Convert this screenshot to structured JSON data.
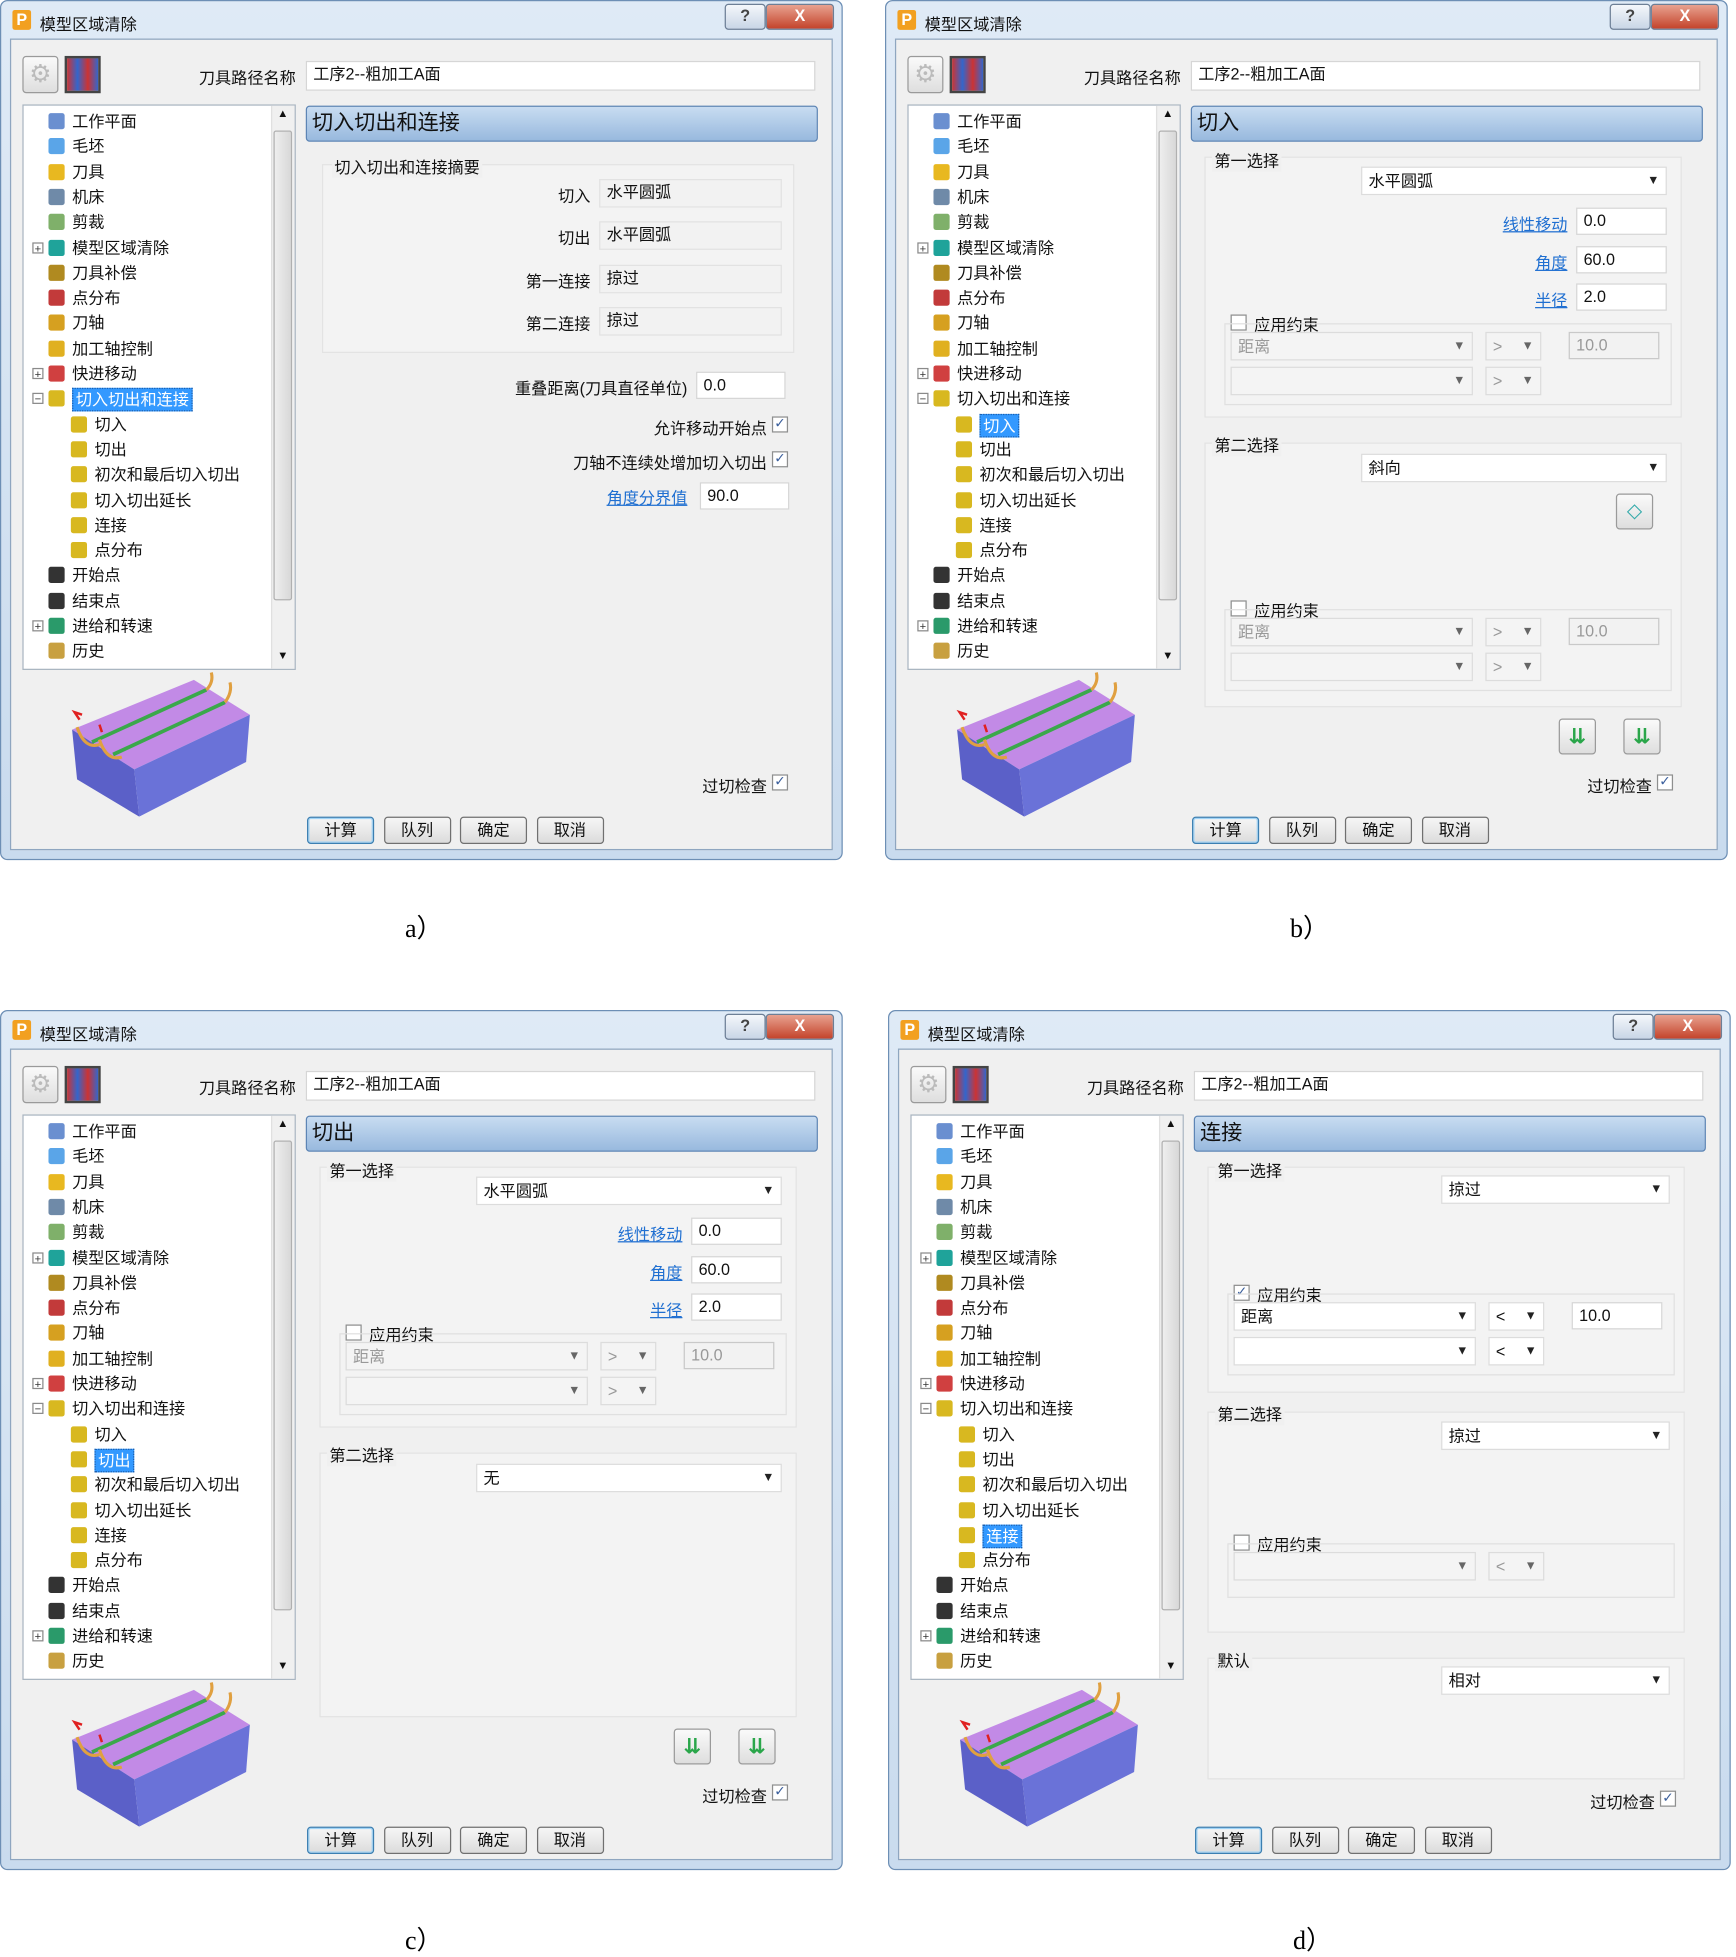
{
  "tree_items": [
    {
      "label": "工作平面",
      "level": 0,
      "icon": "workplane-icon",
      "color": "#6a8fd0"
    },
    {
      "label": "毛坯",
      "level": 0,
      "icon": "block-icon",
      "color": "#5aa5e8"
    },
    {
      "label": "刀具",
      "level": 0,
      "icon": "tool-icon",
      "color": "#e8b820"
    },
    {
      "label": "机床",
      "level": 0,
      "icon": "machine-tool-icon",
      "color": "#6f8aa8"
    },
    {
      "label": "剪裁",
      "level": 0,
      "icon": "limit-icon",
      "color": "#7fb06a"
    },
    {
      "label": "模型区域清除",
      "level": 0,
      "icon": "model-area-clearance-icon",
      "color": "#1fa39a",
      "expander": "+"
    },
    {
      "label": "刀具补偿",
      "level": 0,
      "icon": "tool-compensation-icon",
      "color": "#b08a20"
    },
    {
      "label": "点分布",
      "level": 0,
      "icon": "point-distribution-icon",
      "color": "#c23a3a"
    },
    {
      "label": "刀轴",
      "level": 0,
      "icon": "tool-axis-icon",
      "color": "#d6a020"
    },
    {
      "label": "加工轴控制",
      "level": 0,
      "icon": "axis-control-icon",
      "color": "#e0b020"
    },
    {
      "label": "快进移动",
      "level": 0,
      "icon": "rapid-move-icon",
      "color": "#d04040",
      "expander": "+"
    },
    {
      "label": "切入切出和连接",
      "level": 0,
      "icon": "leads-and-links-icon",
      "color": "#d8b820",
      "expander": "-"
    },
    {
      "label": "切入",
      "level": 1,
      "icon": "leads-and-links-icon",
      "color": "#d8b820"
    },
    {
      "label": "切出",
      "level": 1,
      "icon": "leads-and-links-icon",
      "color": "#d8b820"
    },
    {
      "label": "初次和最后切入切出",
      "level": 1,
      "icon": "leads-and-links-icon",
      "color": "#d8b820"
    },
    {
      "label": "切入切出延长",
      "level": 1,
      "icon": "leads-and-links-icon",
      "color": "#d8b820"
    },
    {
      "label": "连接",
      "level": 1,
      "icon": "leads-and-links-icon",
      "color": "#d8b820"
    },
    {
      "label": "点分布",
      "level": 1,
      "icon": "leads-and-links-icon",
      "color": "#d8b820"
    },
    {
      "label": "开始点",
      "level": 0,
      "icon": "start-point-icon",
      "color": "#333333"
    },
    {
      "label": "结束点",
      "level": 0,
      "icon": "end-point-icon",
      "color": "#333333"
    },
    {
      "label": "进给和转速",
      "level": 0,
      "icon": "feeds-and-speeds-icon",
      "color": "#2a9a6a",
      "expander": "+"
    },
    {
      "label": "历史",
      "level": 0,
      "icon": "history-icon",
      "color": "#c8a040"
    }
  ],
  "common": {
    "title": "模型区域清除",
    "help_label": "?",
    "close_label": "X",
    "toolpath_name_label": "刀具路径名称",
    "toolpath_name_value": "工序2--粗加工A面",
    "overcut_label": "过切检查",
    "overcut_checked": true,
    "buttons": [
      "计算",
      "队列",
      "确定",
      "取消"
    ],
    "colors": {
      "heading": "#98b9de",
      "selection": "#3399ff",
      "link": "#1f6fd1",
      "block_top": "#c28ae6",
      "block_side": "#6a72d8"
    }
  },
  "dialogs": [
    {
      "caption": "a）",
      "selected_tree_index": 11,
      "section_title": "切入切出和连接",
      "kind": "summary",
      "summary": {
        "title": "切入切出和连接摘要",
        "rows": [
          {
            "label": "切入",
            "value": "水平圆弧"
          },
          {
            "label": "切出",
            "value": "水平圆弧"
          },
          {
            "label": "第一连接",
            "value": "掠过"
          },
          {
            "label": "第二连接",
            "value": "掠过"
          }
        ],
        "overlap_label": "重叠距离(刀具直径单位)",
        "overlap_value": "0.0",
        "allow_move_start_label": "允许移动开始点",
        "allow_move_start_checked": true,
        "add_leads_label": "刀轴不连续处增加切入切出",
        "add_leads_checked": true,
        "angle_threshold_label": "角度分界值",
        "angle_threshold_value": "90.0"
      }
    },
    {
      "caption": "b）",
      "selected_tree_index": 12,
      "section_title": "切入",
      "kind": "lead",
      "first": {
        "title": "第一选择",
        "value": "水平圆弧",
        "linear_label": "线性移动",
        "linear_value": "0.0",
        "angle_label": "角度",
        "angle_value": "60.0",
        "radius_label": "半径",
        "radius_value": "2.0",
        "constraint": {
          "label": "应用约束",
          "checked": false,
          "row1_type": "距离",
          "row1_op": ">",
          "row1_value": "10.0",
          "row2_type": "",
          "row2_op": ">"
        }
      },
      "second": {
        "title": "第二选择",
        "value": "斜向",
        "has_options_button": true,
        "constraint": {
          "label": "应用约束",
          "checked": false,
          "row1_type": "距离",
          "row1_op": ">",
          "row1_value": "10.0",
          "row2_type": "",
          "row2_op": ">"
        }
      },
      "has_preset_buttons": true
    },
    {
      "caption": "c）",
      "selected_tree_index": 13,
      "section_title": "切出",
      "kind": "lead",
      "first": {
        "title": "第一选择",
        "value": "水平圆弧",
        "linear_label": "线性移动",
        "linear_value": "0.0",
        "angle_label": "角度",
        "angle_value": "60.0",
        "radius_label": "半径",
        "radius_value": "2.0",
        "constraint": {
          "label": "应用约束",
          "checked": false,
          "row1_type": "距离",
          "row1_op": ">",
          "row1_value": "10.0",
          "row2_type": "",
          "row2_op": ">"
        }
      },
      "second": {
        "title": "第二选择",
        "value": "无"
      },
      "has_preset_buttons": true
    },
    {
      "caption": "d）",
      "selected_tree_index": 16,
      "section_title": "连接",
      "kind": "link",
      "first": {
        "title": "第一选择",
        "value": "掠过",
        "constraint": {
          "label": "应用约束",
          "checked": true,
          "row1_type": "距离",
          "row1_op": "<",
          "row1_value": "10.0",
          "row2_type": "",
          "row2_op": "<"
        }
      },
      "second": {
        "title": "第二选择",
        "value": "掠过",
        "constraint": {
          "label": "应用约束",
          "checked": false,
          "row1_type": "",
          "row1_op": "<"
        }
      },
      "default": {
        "title": "默认",
        "value": "相对"
      }
    }
  ]
}
